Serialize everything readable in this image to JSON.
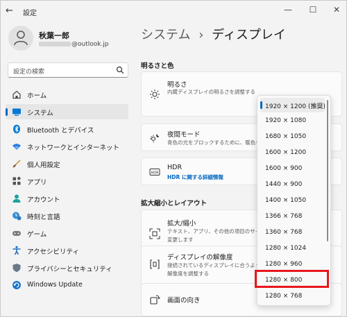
{
  "window": {
    "back_glyph": "←",
    "app_title": "設定",
    "minimize_glyph": "—",
    "maximize_glyph": "☐",
    "close_glyph": "✕"
  },
  "user": {
    "name": "秋葉一郎",
    "email_suffix": "@outlook.jp"
  },
  "search": {
    "placeholder": "設定の検索"
  },
  "nav": {
    "items": [
      {
        "label": "ホーム",
        "icon": "home-icon"
      },
      {
        "label": "システム",
        "icon": "system-icon"
      },
      {
        "label": "Bluetooth とデバイス",
        "icon": "bluetooth-icon"
      },
      {
        "label": "ネットワークとインターネット",
        "icon": "network-icon"
      },
      {
        "label": "個人用設定",
        "icon": "personalization-icon"
      },
      {
        "label": "アプリ",
        "icon": "apps-icon"
      },
      {
        "label": "アカウント",
        "icon": "account-icon"
      },
      {
        "label": "時刻と言語",
        "icon": "time-language-icon"
      },
      {
        "label": "ゲーム",
        "icon": "gaming-icon"
      },
      {
        "label": "アクセシビリティ",
        "icon": "accessibility-icon"
      },
      {
        "label": "プライバシーとセキュリティ",
        "icon": "privacy-icon"
      },
      {
        "label": "Windows Update",
        "icon": "windows-update-icon"
      }
    ],
    "selected_index": 1
  },
  "main": {
    "breadcrumb_parent": "システム",
    "breadcrumb_sep": "›",
    "breadcrumb_current": "ディスプレイ",
    "section_brightness": "明るさと色",
    "brightness": {
      "title": "明るさ",
      "desc": "内蔵ディスプレイの明るさを調整する"
    },
    "night_light": {
      "title": "夜間モード",
      "desc": "青色の光をブロックするために、暖色を使用す"
    },
    "hdr": {
      "title": "HDR",
      "link": "HDR に関する詳細情報"
    },
    "section_scale": "拡大縮小とレイアウト",
    "scale": {
      "title": "拡大/縮小",
      "desc_line1": "テキスト、アプリ、その他の項目のサイズを",
      "desc_line2": "変更します"
    },
    "resolution": {
      "title": "ディスプレイの解像度",
      "desc_line1": "接続されているディスプレイに合うように",
      "desc_line2": "解像度を調整する"
    },
    "orientation": {
      "title": "画面の向き"
    }
  },
  "resolution_dropdown": {
    "options": [
      "1920 × 1200 (推奨)",
      "1920 × 1080",
      "1680 × 1050",
      "1600 × 1200",
      "1600 × 900",
      "1440 × 900",
      "1400 × 1050",
      "1366 × 768",
      "1360 × 768",
      "1280 × 1024",
      "1280 × 960",
      "1280 × 800",
      "1280 × 768"
    ],
    "selected_index": 0,
    "highlighted_option": "1280 × 800"
  },
  "colors": {
    "accent": "#0067c0",
    "highlight_border": "#e8161b"
  }
}
